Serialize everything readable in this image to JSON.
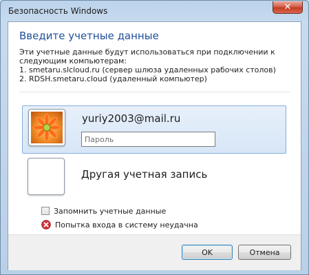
{
  "window": {
    "title": "Безопасность Windows",
    "close_glyph": "✕"
  },
  "dialog": {
    "heading": "Введите учетные данные",
    "description_lines": [
      "Эти учетные данные будут использоваться при подключении к",
      "следующим компьютерам:",
      "1. smetaru.slcloud.ru (сервер шлюза удаленных рабочих столов)",
      "2. RDSH.smetaru.cloud (удаленный компьютер)"
    ]
  },
  "accounts": {
    "selected": {
      "username": "yuriy2003@mail.ru",
      "password_value": "",
      "password_placeholder": "Пароль",
      "avatar_icon": "flower-avatar-icon"
    },
    "other": {
      "label": "Другая учетная запись",
      "avatar_icon": "blank-avatar-icon"
    }
  },
  "options": {
    "remember_label": "Запомнить учетные данные",
    "remember_checked": false,
    "error_text": "Попытка входа в систему неудачна",
    "error_icon": "error-icon"
  },
  "buttons": {
    "ok_label": "OK",
    "cancel_label": "Отмена"
  },
  "colors": {
    "heading": "#1e4f9a",
    "frame": "#bcd3ea",
    "selected_tile": "#d7e6f7",
    "error_red": "#c8202a"
  }
}
